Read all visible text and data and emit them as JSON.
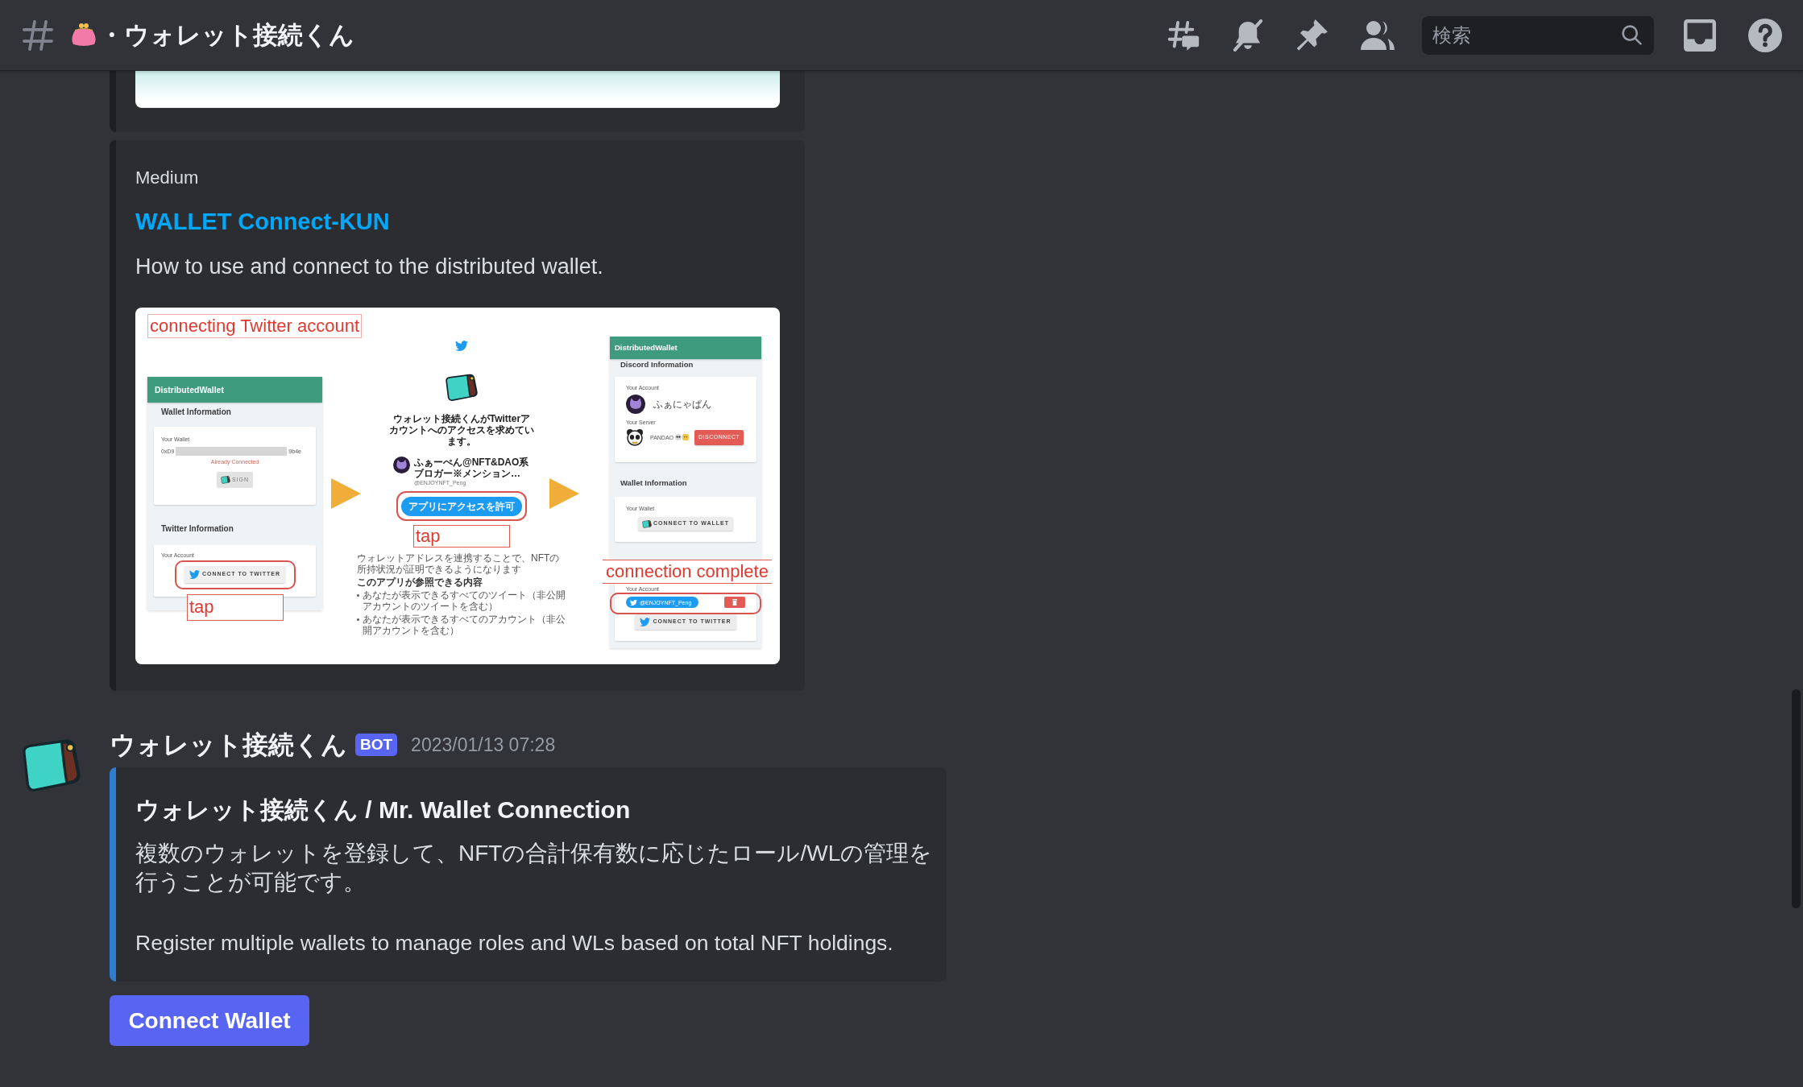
{
  "header": {
    "channel_name": "・ウォレット接続くん",
    "search_placeholder": "検索"
  },
  "embeds": [
    {
      "kind": "image"
    },
    {
      "kind": "link",
      "provider": "Medium",
      "title": "WALLET Connect-KUN",
      "description": "How to use and connect to the distributed wallet.",
      "screenshot": {
        "step_1": {
          "caption": "connecting Twitter account",
          "app_title": "DistributedWallet",
          "wallet_heading": "Wallet Information",
          "wallet_label": "Your Wallet",
          "address_start": "0xD9",
          "address_end": "9b4e",
          "wallet_status": "Already Connected",
          "sign_button": "SIGN",
          "twitter_heading": "Twitter Information",
          "account_label": "Your Account",
          "twitter_button": "CONNECT TO TWITTER",
          "note": "tap"
        },
        "step_2": {
          "heading": "ウォレット接続くんがTwitterアカウントへのアクセスを求めています。",
          "user_name": "ふぁーぺん@NFT&DAO系ブロガー※メンション…",
          "user_handle": "@ENJOYNFT_Peng",
          "authorize_button": "アプリにアクセスを許可",
          "note": "tap",
          "notice": "ウォレットアドレスを連携することで、NFTの所持状況が証明できるようになります",
          "permissions_heading": "このアプリが参照できる内容",
          "permissions": [
            "あなたが表示できるすべてのツイート（非公開アカウントのツイートを含む）",
            "あなたが表示できるすべてのアカウント（非公開アカウントを含む）"
          ]
        },
        "step_3": {
          "app_title": "DistributedWallet",
          "discord_heading": "Discord Information",
          "account_label": "Your Account",
          "account_name": "ふぁにゃぱん",
          "server_label": "Your Server",
          "server_name": "PANDAO",
          "disconnect_button": "DISCONNECT",
          "wallet_heading": "Wallet Information",
          "wallet_label": "Your Wallet",
          "wallet_button": "CONNECT TO WALLET",
          "note": "connection complete",
          "twitter_account_label": "Your Account",
          "twitter_handle": "@ENJOYNFT_Peng",
          "twitter_button": "CONNECT TO TWITTER"
        }
      }
    }
  ],
  "message": {
    "author": "ウォレット接続くん",
    "tag": "BOT",
    "timestamp": "2023/01/13 07:28",
    "embed": {
      "title": "ウォレット接続くん / Mr. Wallet Connection",
      "paragraphs": [
        "複数のウォレットを登録して、NFTの合計保有数に応じたロール/WLの管理を行うことが可能です。",
        "Register multiple wallets to manage roles and WLs based on total NFT holdings."
      ]
    },
    "buttons": [
      {
        "label": "Connect Wallet"
      }
    ]
  }
}
